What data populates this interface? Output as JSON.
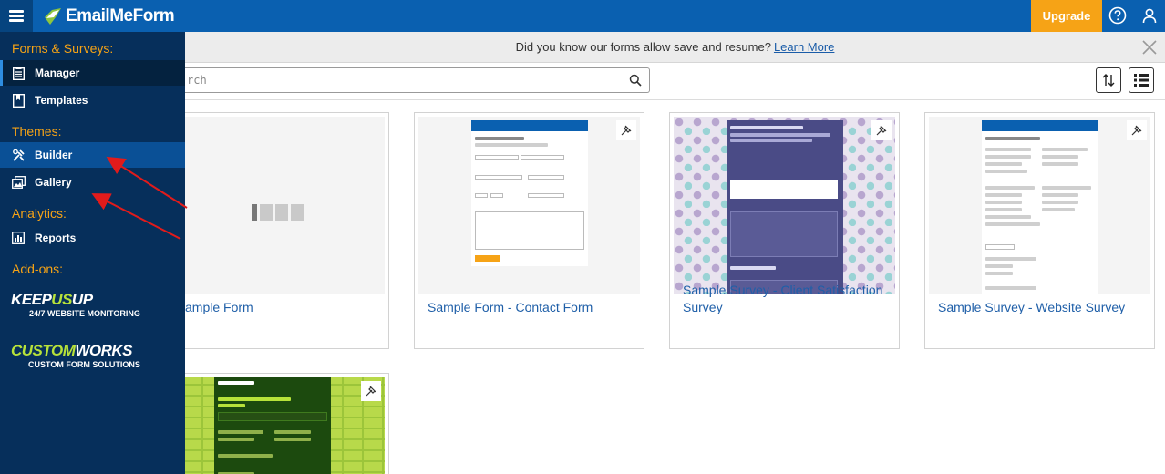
{
  "topbar": {
    "logo_text": "EmailMeForm",
    "upgrade_label": "Upgrade",
    "icons": [
      "menu-icon",
      "help-icon",
      "user-icon"
    ]
  },
  "notice": {
    "text": "Did you know our forms allow save and resume?",
    "link": "Learn More"
  },
  "search": {
    "placeholder": "rch"
  },
  "sidebar": {
    "sections": {
      "forms": "Forms & Surveys:",
      "themes": "Themes:",
      "analytics": "Analytics:",
      "addons": "Add-ons:"
    },
    "items": [
      {
        "label": "Manager",
        "icon": "clipboard-icon"
      },
      {
        "label": "Templates",
        "icon": "bookmark-icon"
      },
      {
        "label": "Builder",
        "icon": "tools-icon"
      },
      {
        "label": "Gallery",
        "icon": "images-icon"
      },
      {
        "label": "Reports",
        "icon": "bar-chart-icon"
      }
    ],
    "addons": [
      {
        "title_a": "KEEP",
        "title_b": "US",
        "title_c": "UP",
        "subtitle": "24/7 WEBSITE MONITORING"
      },
      {
        "title_a": "CUSTOM",
        "title_b": "WORKS",
        "subtitle": "CUSTOM FORM SOLUTIONS"
      }
    ]
  },
  "cards": [
    {
      "title": "ample Form"
    },
    {
      "title": "Sample Form - Contact Form"
    },
    {
      "title": "Sample Survey - Client Satisfaction Survey"
    },
    {
      "title": "Sample Survey - Website Survey"
    },
    {
      "title": ""
    }
  ],
  "colors": {
    "topbar": "#0a60b0",
    "sidebar": "#062f5b",
    "accent": "#f6a316",
    "link": "#1f5fa8"
  }
}
